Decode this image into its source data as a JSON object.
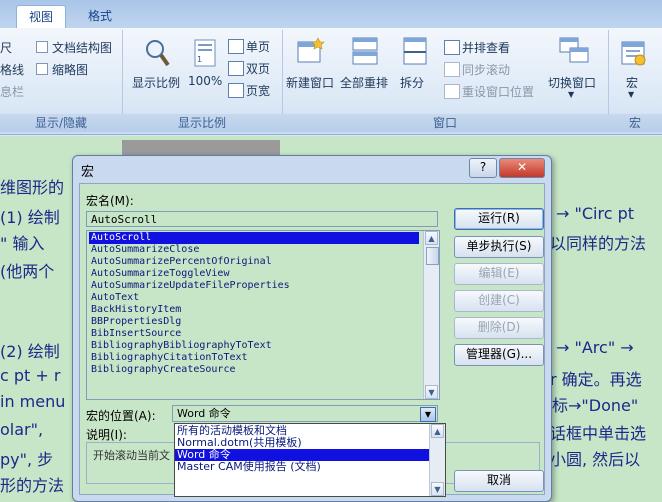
{
  "ribbon": {
    "tabs": [
      {
        "label": "",
        "active": false
      },
      {
        "label": "视图",
        "active": true
      },
      {
        "label": "格式",
        "active": false
      }
    ],
    "show_hide": {
      "label": "显示/隐藏",
      "items": [
        "尺",
        "格线",
        "息栏"
      ],
      "checks": [
        "文档结构图",
        "缩略图"
      ]
    },
    "zoom": {
      "label": "显示比例",
      "zoom_button": "显示比例",
      "pct_button": "100%",
      "one_page": "单页",
      "two_page": "双页",
      "page_width": "页宽"
    },
    "window": {
      "label": "窗口",
      "new_window": "新建窗口",
      "arrange_all": "全部重排",
      "split": "拆分",
      "side_by_side": "并排查看",
      "sync_scroll": "同步滚动",
      "reset_position": "重设窗口位置",
      "switch_window": "切换窗口"
    },
    "macro": {
      "label": "宏",
      "macro_button": "宏"
    }
  },
  "document": {
    "lines": [
      "维图形的",
      "(1) 绘制",
      "\" 输入",
      "(他两个",
      "(2) 绘制",
      "c pt + r",
      "in menu",
      "olar\",",
      "py\", 步",
      "形的方法"
    ],
    "right_lines": [
      "→ \"Circ pt",
      "以同样的方法",
      "→ \"Arc\" →",
      "r 确定。再选",
      "标→\"Done\"",
      "话框中单击选",
      "小圆, 然后以"
    ]
  },
  "dialog": {
    "title": "宏",
    "help_button": "?",
    "name_label": "宏名(M):",
    "name_value": "AutoScroll",
    "macros": [
      {
        "name": "AutoScroll",
        "selected": true
      },
      {
        "name": "AutoSummarizeClose",
        "selected": false
      },
      {
        "name": "AutoSummarizePercentOfOriginal",
        "selected": false
      },
      {
        "name": "AutoSummarizeToggleView",
        "selected": false
      },
      {
        "name": "AutoSummarizeUpdateFileProperties",
        "selected": false
      },
      {
        "name": "AutoText",
        "selected": false
      },
      {
        "name": "BackHistoryItem",
        "selected": false
      },
      {
        "name": "BBPropertiesDlg",
        "selected": false
      },
      {
        "name": "BibInsertSource",
        "selected": false
      },
      {
        "name": "BibliographyBibliographyToText",
        "selected": false
      },
      {
        "name": "BibliographyCitationToText",
        "selected": false
      },
      {
        "name": "BibliographyCreateSource",
        "selected": false
      }
    ],
    "buttons": {
      "run": "运行(R)",
      "step": "单步执行(S)",
      "edit": "编辑(E)",
      "create": "创建(C)",
      "delete": "删除(D)",
      "organizer": "管理器(G)...",
      "cancel": "取消"
    },
    "location_label": "宏的位置(A):",
    "location_value": "Word 命令",
    "location_options": [
      {
        "label": "所有的活动模板和文档",
        "selected": false
      },
      {
        "label": "Normal.dotm(共用模板)",
        "selected": false
      },
      {
        "label": "Word 命令",
        "selected": true
      },
      {
        "label": "Master CAM使用报告 (文档)",
        "selected": false
      }
    ],
    "desc_label": "说明(I):",
    "desc_value": "开始滚动当前文"
  },
  "colors": {
    "selection": "#1010e0",
    "eye_care_green": "#c7e6c7",
    "ribbon_blue": "#dbe7f5"
  }
}
